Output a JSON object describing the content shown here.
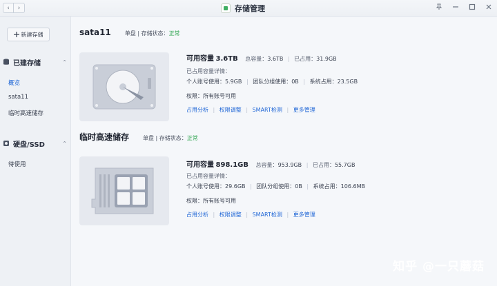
{
  "window": {
    "title": "存储管理",
    "nav_back": "‹",
    "nav_forward": "›"
  },
  "sidebar": {
    "new_button": {
      "icon": "plus-icon",
      "label": "新建存储"
    },
    "groups": [
      {
        "label": "已建存储",
        "icon": "database-icon",
        "items": [
          {
            "label": "概览",
            "active": true
          },
          {
            "label": "sata11"
          },
          {
            "label": "临时高速储存"
          }
        ]
      },
      {
        "label": "硬盘/SSD",
        "icon": "disk-icon",
        "items": [
          {
            "label": "待使用"
          }
        ]
      }
    ]
  },
  "volumes": [
    {
      "name": "sata11",
      "mode": "单盘",
      "status_label": "存储状态：",
      "status": "正常",
      "device_icon": "hdd-icon",
      "capacity_label": "可用容量",
      "capacity": "3.6TB",
      "total_label": "总容量：",
      "total": "3.6TB",
      "used_label": "已占用：",
      "used": "31.9GB",
      "detail_label": "已占用容量详情：",
      "personal_label": "个人账号使用：",
      "personal": "5.9GB",
      "team_label": "团队分组使用：",
      "team": "0B",
      "system_label": "系统占用：",
      "system": "23.5GB",
      "perm_label": "权限：",
      "perm": "所有账号可用",
      "links": [
        "占用分析",
        "权限调整",
        "SMART检测",
        "更多管理"
      ]
    },
    {
      "name": "临时高速储存",
      "mode": "单盘",
      "status_label": "存储状态：",
      "status": "正常",
      "device_icon": "ssd-icon",
      "capacity_label": "可用容量",
      "capacity": "898.1GB",
      "total_label": "总容量：",
      "total": "953.9GB",
      "used_label": "已占用：",
      "used": "55.7GB",
      "detail_label": "已占用容量详情：",
      "personal_label": "个人账号使用：",
      "personal": "29.6GB",
      "team_label": "团队分组使用：",
      "team": "0B",
      "system_label": "系统占用：",
      "system": "106.6MB",
      "perm_label": "权限：",
      "perm": "所有账号可用",
      "links": [
        "占用分析",
        "权限调整",
        "SMART检测",
        "更多管理"
      ]
    }
  ],
  "watermark": "知乎 @一只蘑菇"
}
